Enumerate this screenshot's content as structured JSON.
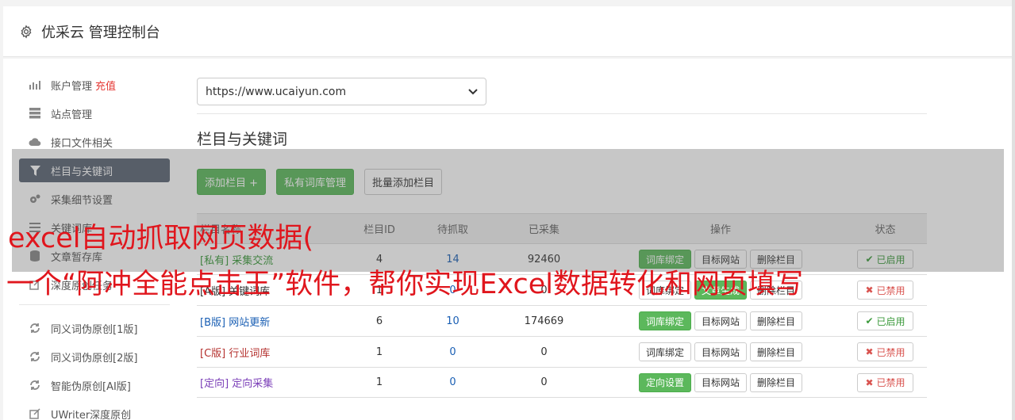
{
  "header": {
    "title": "优采云 管理控制台",
    "icon": "gear-icon"
  },
  "sidebar": {
    "items": [
      {
        "label": "账户管理",
        "badge": "充值",
        "icon": "bar-chart-icon"
      },
      {
        "label": "站点管理",
        "icon": "server-icon"
      },
      {
        "label": "接口文件相关",
        "icon": "cloud-upload-icon"
      },
      {
        "label": "栏目与关键词",
        "icon": "filter-icon",
        "active": true
      },
      {
        "label": "采集细节设置",
        "icon": "cogs-icon"
      },
      {
        "label": "关键词库",
        "icon": "list-icon"
      },
      {
        "label": "文章暂存库",
        "icon": "database-icon"
      },
      {
        "label": "深度原创任务",
        "icon": "edit-icon"
      }
    ],
    "items2": [
      {
        "label": "同义词伪原创[1版]",
        "icon": "refresh-icon"
      },
      {
        "label": "同义词伪原创[2版]",
        "icon": "refresh-icon"
      },
      {
        "label": "智能伪原创[AI版]",
        "icon": "refresh-icon"
      },
      {
        "label": "UWriter深度原创",
        "icon": "edit-icon"
      }
    ]
  },
  "main": {
    "site_select": "https://www.ucaiyun.com",
    "section_title": "栏目与关键词",
    "buttons": {
      "add_column": "添加栏目 +",
      "private_lib": "私有词库管理",
      "batch_add": "批量添加栏目"
    },
    "table": {
      "headers": {
        "name": "栏目名称",
        "id": "栏目ID",
        "wait": "待抓取",
        "done": "已采集",
        "ops": "操作",
        "status": "状态"
      },
      "rows": [
        {
          "name": "[私有] 采集交流",
          "id": "4",
          "wait": "14",
          "done": "92460",
          "op1": "词库绑定",
          "op1_green": true,
          "op2": "目标网站",
          "op3": "删除栏目",
          "status": "已启用",
          "on": true,
          "color": "#3c9a3c"
        },
        {
          "name": "[A版] 关键词库",
          "id": "1",
          "wait": "0",
          "done": "0",
          "op1": "词库绑定",
          "op1_green": false,
          "op2": "文章生成",
          "op2_green": true,
          "op3": "删除栏目",
          "status": "已禁用",
          "on": false,
          "color": "#333333"
        },
        {
          "name": "[B版] 网站更新",
          "id": "6",
          "wait": "10",
          "done": "174669",
          "op1": "词库绑定",
          "op1_green": true,
          "op2": "目标网站",
          "op3": "删除栏目",
          "status": "已启用",
          "on": true,
          "color": "#1a5fb4"
        },
        {
          "name": "[C版] 行业词库",
          "id": "1",
          "wait": "0",
          "done": "0",
          "op1": "词库绑定",
          "op1_green": false,
          "op2": "目标网站",
          "op3": "删除栏目",
          "status": "已禁用",
          "on": false,
          "color": "#b5322f"
        },
        {
          "name": "[定向] 定向采集",
          "id": "1",
          "wait": "0",
          "done": "0",
          "op1": "定向设置",
          "op1_green": true,
          "op2": "目标网站",
          "op3": "删除栏目",
          "status": "已禁用",
          "on": false,
          "color": "#7b3fb8"
        }
      ]
    }
  },
  "overlay": {
    "line1": "excel自动抓取网页数据(",
    "line2": "一个“阿冲全能点击王”软件，帮你实现Excel数据转化和网页填写"
  }
}
